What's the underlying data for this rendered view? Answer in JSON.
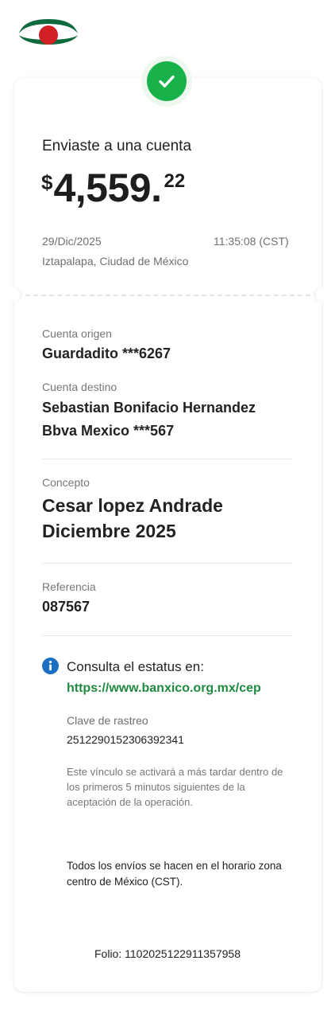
{
  "header": {
    "logo_icon": "bank-logo-icon"
  },
  "status": {
    "icon": "check-icon",
    "color": "#19b24a"
  },
  "transfer": {
    "title": "Enviaste a una cuenta",
    "currency": "$",
    "amount_int": "4,559.",
    "amount_dec": "22",
    "date": "29/Dic/2025",
    "time": "11:35:08 (CST)",
    "location": "Iztapalapa, Ciudad de México"
  },
  "details": {
    "origin_label": "Cuenta origen",
    "origin_value": "Guardadito ***6267",
    "dest_label": "Cuenta destino",
    "dest_name": "Sebastian Bonifacio Hernandez",
    "dest_bank": "Bbva Mexico ***567",
    "concept_label": "Concepto",
    "concept_line1": "Cesar lopez Andrade",
    "concept_line2": "Diciembre 2025",
    "reference_label": "Referencia",
    "reference_value": "087567"
  },
  "tracking": {
    "info_icon": "info-icon",
    "accent": "#1f8a3f",
    "title": "Consulta el estatus en:",
    "link": "https://www.banxico.org.mx/cep",
    "key_label": "Clave de rastreo",
    "key_value": "2512290152306392341",
    "note": "Este vínculo se activará a más tardar dentro de los primeros 5 minutos siguientes de la aceptación de la operación.",
    "timezone_note": "Todos los envíos se hacen en el horario zona centro de México (CST)."
  },
  "footer": {
    "folio": "Folio: 1102025122911357958"
  }
}
